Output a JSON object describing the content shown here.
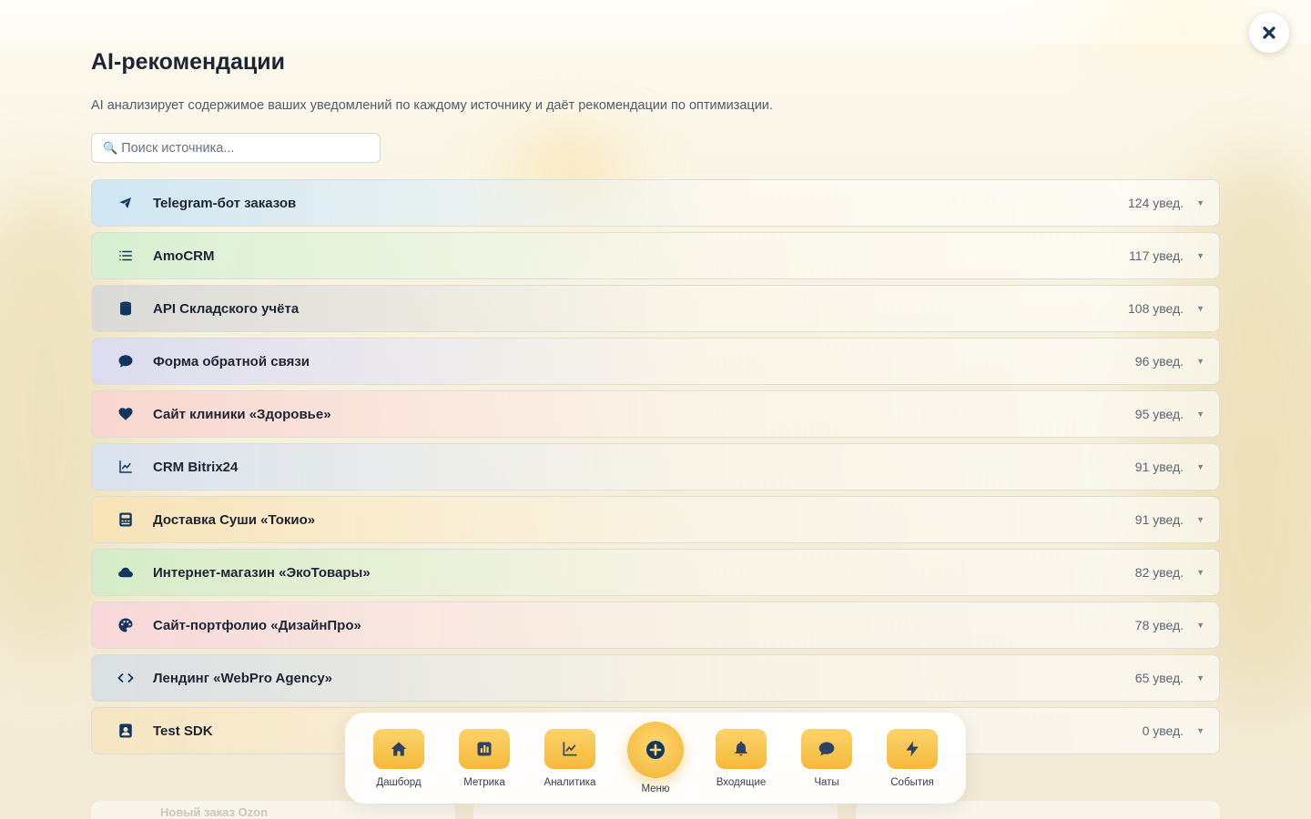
{
  "modal": {
    "title": "AI-рекомендации",
    "subtitle": "AI анализирует содержимое ваших уведомлений по каждому источнику и даёт рекомендации по оптимизации.",
    "search_placeholder": "Поиск источника..."
  },
  "sources": [
    {
      "name": "Telegram-бот заказов",
      "count": "124 увед.",
      "icon": "telegram-icon",
      "tint": "#cfe6f4"
    },
    {
      "name": "AmoCRM",
      "count": "117 увед.",
      "icon": "list-icon",
      "tint": "#d8efd2"
    },
    {
      "name": "API Складского учёта",
      "count": "108 увед.",
      "icon": "database-icon",
      "tint": "#d9d9d6"
    },
    {
      "name": "Форма обратной связи",
      "count": "96 увед.",
      "icon": "chat-icon",
      "tint": "#dcdcf0"
    },
    {
      "name": "Сайт клиники «Здоровье»",
      "count": "95 увед.",
      "icon": "heart-icon",
      "tint": "#f8d6d0"
    },
    {
      "name": "CRM Bitrix24",
      "count": "91 увед.",
      "icon": "chart-line-icon",
      "tint": "#d9e2ee"
    },
    {
      "name": "Доставка Суши «Токио»",
      "count": "91 увед.",
      "icon": "register-icon",
      "tint": "#f8e3b8"
    },
    {
      "name": "Интернет-магазин «ЭкоТовары»",
      "count": "82 увед.",
      "icon": "cloud-icon",
      "tint": "#d6ecc8"
    },
    {
      "name": "Сайт-портфолио «ДизайнПро»",
      "count": "78 увед.",
      "icon": "palette-icon",
      "tint": "#f8d8da"
    },
    {
      "name": "Лендинг «WebPro Agency»",
      "count": "65 увед.",
      "icon": "code-icon",
      "tint": "#dadfe2"
    },
    {
      "name": "Test SDK",
      "count": "0 увед.",
      "icon": "user-card-icon",
      "tint": "#f6e6c2"
    }
  ],
  "nav": {
    "items": [
      {
        "label": "Дашборд",
        "icon": "home-icon"
      },
      {
        "label": "Метрика",
        "icon": "metrics-icon"
      },
      {
        "label": "Аналитика",
        "icon": "analytics-icon"
      },
      {
        "label": "Входящие",
        "icon": "bell-icon"
      },
      {
        "label": "Чаты",
        "icon": "chat-icon"
      },
      {
        "label": "События",
        "icon": "bolt-icon"
      }
    ],
    "center": {
      "label": "Меню",
      "icon": "plus-circle-icon"
    }
  },
  "background": {
    "ghost_item": "Новый заказ Ozon"
  },
  "colors": {
    "accent": "#f5b83a",
    "icon_navy": "#123660",
    "text": "#1d2433"
  }
}
